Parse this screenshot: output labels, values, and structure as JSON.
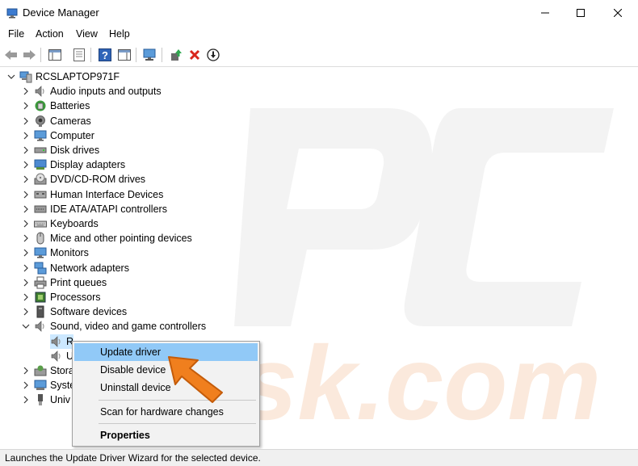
{
  "window": {
    "title": "Device Manager",
    "controls": [
      "minimize",
      "maximize",
      "close"
    ]
  },
  "menu": [
    "File",
    "Action",
    "View",
    "Help"
  ],
  "toolbar": {
    "buttons": [
      "back-icon",
      "forward-icon",
      "show-hide-console-tree-icon",
      "properties-icon",
      "help-icon",
      "action-pane-icon",
      "scan-hardware-icon",
      "update-driver-icon",
      "uninstall-icon",
      "disable-icon"
    ]
  },
  "tree": {
    "root": "RCSLAPTOP971F",
    "categories": [
      {
        "label": "Audio inputs and outputs",
        "icon": "speaker-icon"
      },
      {
        "label": "Batteries",
        "icon": "battery-icon"
      },
      {
        "label": "Cameras",
        "icon": "camera-icon"
      },
      {
        "label": "Computer",
        "icon": "monitor-icon"
      },
      {
        "label": "Disk drives",
        "icon": "disk-icon"
      },
      {
        "label": "Display adapters",
        "icon": "display-adapter-icon"
      },
      {
        "label": "DVD/CD-ROM drives",
        "icon": "dvd-icon"
      },
      {
        "label": "Human Interface Devices",
        "icon": "hid-icon"
      },
      {
        "label": "IDE ATA/ATAPI controllers",
        "icon": "ide-icon"
      },
      {
        "label": "Keyboards",
        "icon": "keyboard-icon"
      },
      {
        "label": "Mice and other pointing devices",
        "icon": "mouse-icon"
      },
      {
        "label": "Monitors",
        "icon": "monitor-icon"
      },
      {
        "label": "Network adapters",
        "icon": "network-icon"
      },
      {
        "label": "Print queues",
        "icon": "printer-icon"
      },
      {
        "label": "Processors",
        "icon": "processor-icon"
      },
      {
        "label": "Software devices",
        "icon": "software-device-icon"
      },
      {
        "label": "Sound, video and game controllers",
        "icon": "speaker-icon",
        "expanded": true
      }
    ],
    "children": [
      {
        "label": "R",
        "icon": "speaker-icon"
      },
      {
        "label": "U",
        "icon": "speaker-icon"
      }
    ],
    "after": [
      {
        "label": "Stora",
        "icon": "storage-icon"
      },
      {
        "label": "Syste",
        "icon": "system-icon"
      },
      {
        "label": "Univ",
        "icon": "usb-icon"
      }
    ]
  },
  "context_menu": {
    "items": [
      {
        "label": "Update driver",
        "highlighted": true
      },
      {
        "label": "Disable device"
      },
      {
        "label": "Uninstall device"
      },
      {
        "separator": true
      },
      {
        "label": "Scan for hardware changes"
      },
      {
        "separator": true
      },
      {
        "label": "Properties",
        "bold": true
      }
    ]
  },
  "status": {
    "text": "Launches the Update Driver Wizard for the selected device."
  },
  "colors": {
    "selection": "#cce8ff",
    "menu_highlight": "#91c9f7",
    "arrow": "#f07f1e"
  }
}
